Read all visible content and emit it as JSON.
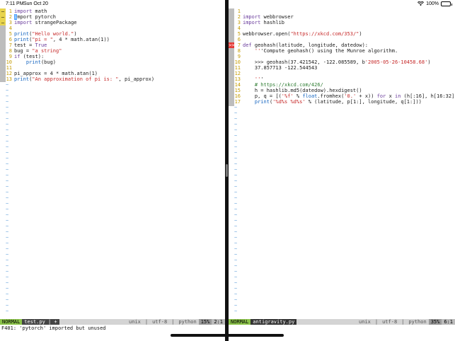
{
  "status_bar": {
    "time": "7:11 PM",
    "date": "Sun Oct 20",
    "battery_text": "100%",
    "battery_level": 1.0
  },
  "left_pane": {
    "lines": [
      {
        "num": "1",
        "text": "import math"
      },
      {
        "num": "2",
        "text": "import pytorch"
      },
      {
        "num": "3",
        "text": "import strangePackage"
      },
      {
        "num": "4",
        "text": ""
      },
      {
        "num": "5",
        "text": "print(\"Hello world.\")"
      },
      {
        "num": "6",
        "text": "print(\"pi = \", 4 * math.atan(1))"
      },
      {
        "num": "7",
        "text": "test = True"
      },
      {
        "num": "8",
        "text": "bug = \"a string\""
      },
      {
        "num": "9",
        "text": "if (test):"
      },
      {
        "num": "10",
        "text": "    print(bug)"
      },
      {
        "num": "11",
        "text": ""
      },
      {
        "num": "12",
        "text": "pi_approx = 4 * math.atan(1)"
      },
      {
        "num": "13",
        "text": "print(\"An approximation of pi is: \", pi_approx)"
      }
    ],
    "signs": [
      "—",
      "—",
      "—"
    ],
    "modeline": {
      "mode": "NORMAL",
      "filename": "test.py | +",
      "fileformat": "unix",
      "encoding": "utf-8",
      "filetype": "python",
      "percent": "15%",
      "position": "2:1"
    }
  },
  "right_pane": {
    "lines": [
      {
        "num": "1",
        "text": ""
      },
      {
        "num": "2",
        "text": "import webbrowser"
      },
      {
        "num": "3",
        "text": "import hashlib"
      },
      {
        "num": "4",
        "text": ""
      },
      {
        "num": "5",
        "text": "webbrowser.open(\"https://xkcd.com/353/\")"
      },
      {
        "num": "6",
        "text": ""
      },
      {
        "num": "7",
        "text": "def geohash(latitude, longitude, datedow):"
      },
      {
        "num": "8",
        "text": "    '''Compute geohash() using the Munroe algorithm."
      },
      {
        "num": "9",
        "text": ""
      },
      {
        "num": "10",
        "text": "    >>> geohash(37.421542, -122.085589, b'2005-05-26-10458.68')"
      },
      {
        "num": "11",
        "text": "    37.857713 -122.544543"
      },
      {
        "num": "12",
        "text": ""
      },
      {
        "num": "13",
        "text": "    '''"
      },
      {
        "num": "14",
        "text": "    # https://xkcd.com/426/"
      },
      {
        "num": "15",
        "text": "    h = hashlib.md5(datedow).hexdigest()"
      },
      {
        "num": "16",
        "text": "    p, q = [('%f' % float.fromhex('0.' + x)) for x in (h[:16], h[16:32])]"
      },
      {
        "num": "17",
        "text": "    print('%d%s %d%s' % (latitude, p[1:], longitude, q[1:]))"
      }
    ],
    "signs": [
      ">>"
    ],
    "modeline": {
      "mode": "NORMAL",
      "filename": "antigravity.py",
      "fileformat": "unix",
      "encoding": "utf-8",
      "filetype": "python",
      "percent": "35%",
      "position": "6:1"
    }
  },
  "command_line": {
    "message": "F401: 'pytorch' imported but unused"
  },
  "empty_line_marker": "~"
}
